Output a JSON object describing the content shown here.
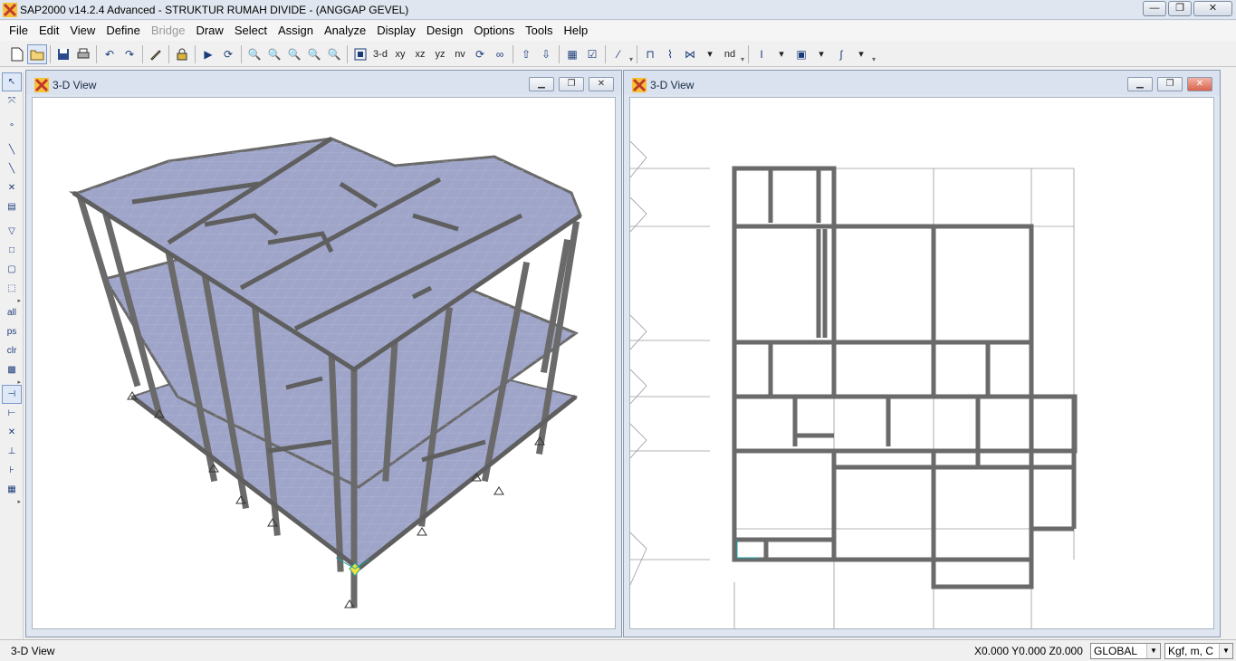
{
  "app": {
    "title": "SAP2000 v14.2.4 Advanced  - STRUKTUR RUMAH DIVIDE - (ANGGAP GEVEL)",
    "window_buttons": {
      "minimize": "—",
      "restore": "❐",
      "close": "✕"
    }
  },
  "menu": [
    {
      "label": "File",
      "enabled": true
    },
    {
      "label": "Edit",
      "enabled": true
    },
    {
      "label": "View",
      "enabled": true
    },
    {
      "label": "Define",
      "enabled": true
    },
    {
      "label": "Bridge",
      "enabled": false
    },
    {
      "label": "Draw",
      "enabled": true
    },
    {
      "label": "Select",
      "enabled": true
    },
    {
      "label": "Assign",
      "enabled": true
    },
    {
      "label": "Analyze",
      "enabled": true
    },
    {
      "label": "Display",
      "enabled": true
    },
    {
      "label": "Design",
      "enabled": true
    },
    {
      "label": "Options",
      "enabled": true
    },
    {
      "label": "Tools",
      "enabled": true
    },
    {
      "label": "Help",
      "enabled": true
    }
  ],
  "toolbar": {
    "view_buttons": {
      "three_d": "3-d",
      "xy": "xy",
      "xz": "xz",
      "yz": "yz",
      "nv": "nv"
    },
    "nd_label": "nd",
    "icons": [
      "new-model-icon",
      "open-icon",
      "save-icon",
      "print-icon",
      "undo-icon",
      "redo-icon",
      "pencil-icon",
      "lock-icon",
      "run-analysis-icon",
      "rotate-3d-icon",
      "zoom-rubber-icon",
      "restore-full-view-icon",
      "zoom-previous-icon",
      "zoom-in-icon",
      "zoom-out-icon",
      "pan-icon"
    ]
  },
  "lefttool": {
    "labels": {
      "all": "all",
      "ps": "ps",
      "clr": "clr"
    }
  },
  "windows": {
    "left": {
      "title": "3-D View",
      "active": false
    },
    "right": {
      "title": "3-D View",
      "active": true
    }
  },
  "status": {
    "left": "3-D View",
    "coords": "X0.000  Y0.000  Z0.000",
    "coord_system": "GLOBAL",
    "units": "Kgf, m, C"
  },
  "colors": {
    "slab": "#9fa5c9",
    "frame": "#6a6a6a",
    "window_bg": "#ffffff"
  }
}
